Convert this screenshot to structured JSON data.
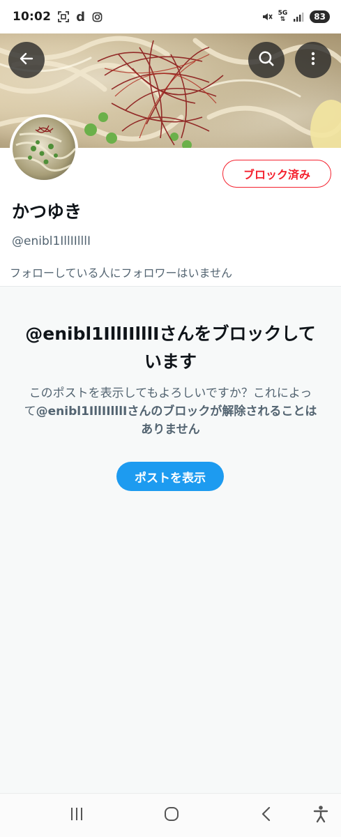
{
  "status_bar": {
    "time": "10:02",
    "battery": "83",
    "network": "5G"
  },
  "toolbar": {
    "back_icon": "arrow-left-icon",
    "search_icon": "search-icon",
    "more_icon": "more-vertical-icon"
  },
  "profile": {
    "block_button_label": "ブロック済み",
    "display_name": "かつゆき",
    "handle": "@enibl1IllIIlllI",
    "follow_info": "フォローしている人にフォロワーはいません"
  },
  "blocked_panel": {
    "title": "@enibl1IllIIlllIさんをブロックしています",
    "body_prefix": "このポストを表示してもよろしいですか？これによって",
    "body_bold": "@enibl1IllIIlllIさんのブロックが解除されることはありません",
    "show_button_label": "ポストを表示"
  },
  "colors": {
    "accent": "#1d9bf0",
    "danger": "#f4212e",
    "muted_text": "#536471",
    "panel_bg": "#f7f9f9"
  }
}
